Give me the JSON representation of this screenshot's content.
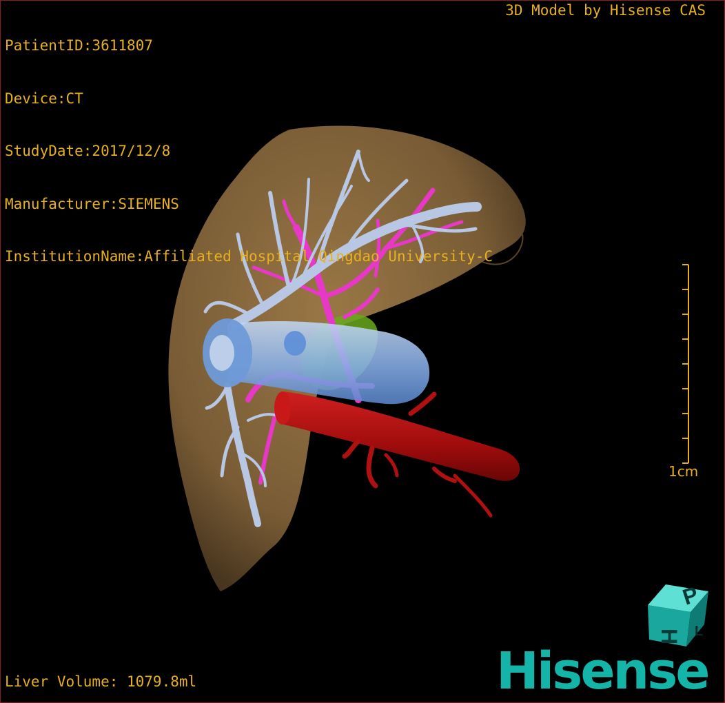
{
  "header": {
    "patient_id": "PatientID:3611807",
    "device": "Device:CT",
    "study_date": "StudyDate:2017/12/8",
    "manufacturer": "Manufacturer:SIEMENS",
    "institution": "InstitutionName:Affiliated Hospital Qingdao University-C"
  },
  "model_credit": "3D Model by Hisense CAS",
  "scale_bar": {
    "label": "1cm"
  },
  "footer": {
    "liver_volume": "Liver Volume: 1079.8ml"
  },
  "brand": {
    "name": "Hisense",
    "cube_letters": [
      "H",
      "P",
      "L"
    ]
  },
  "colors": {
    "overlay_text": "#e8b020",
    "liver": "#8a6a3e",
    "portal_vein": "#b8c8e4",
    "hepatic_artery": "#e838c8",
    "vena_cava": "#7aa6e6",
    "aorta": "#b01010",
    "gallbladder": "#7cb82a",
    "brand": "#14b4a8"
  },
  "structures": [
    "liver-surface-icon",
    "portal-vein-icon",
    "hepatic-artery-icon",
    "inferior-vena-cava-icon",
    "aorta-icon",
    "gallbladder-icon"
  ]
}
